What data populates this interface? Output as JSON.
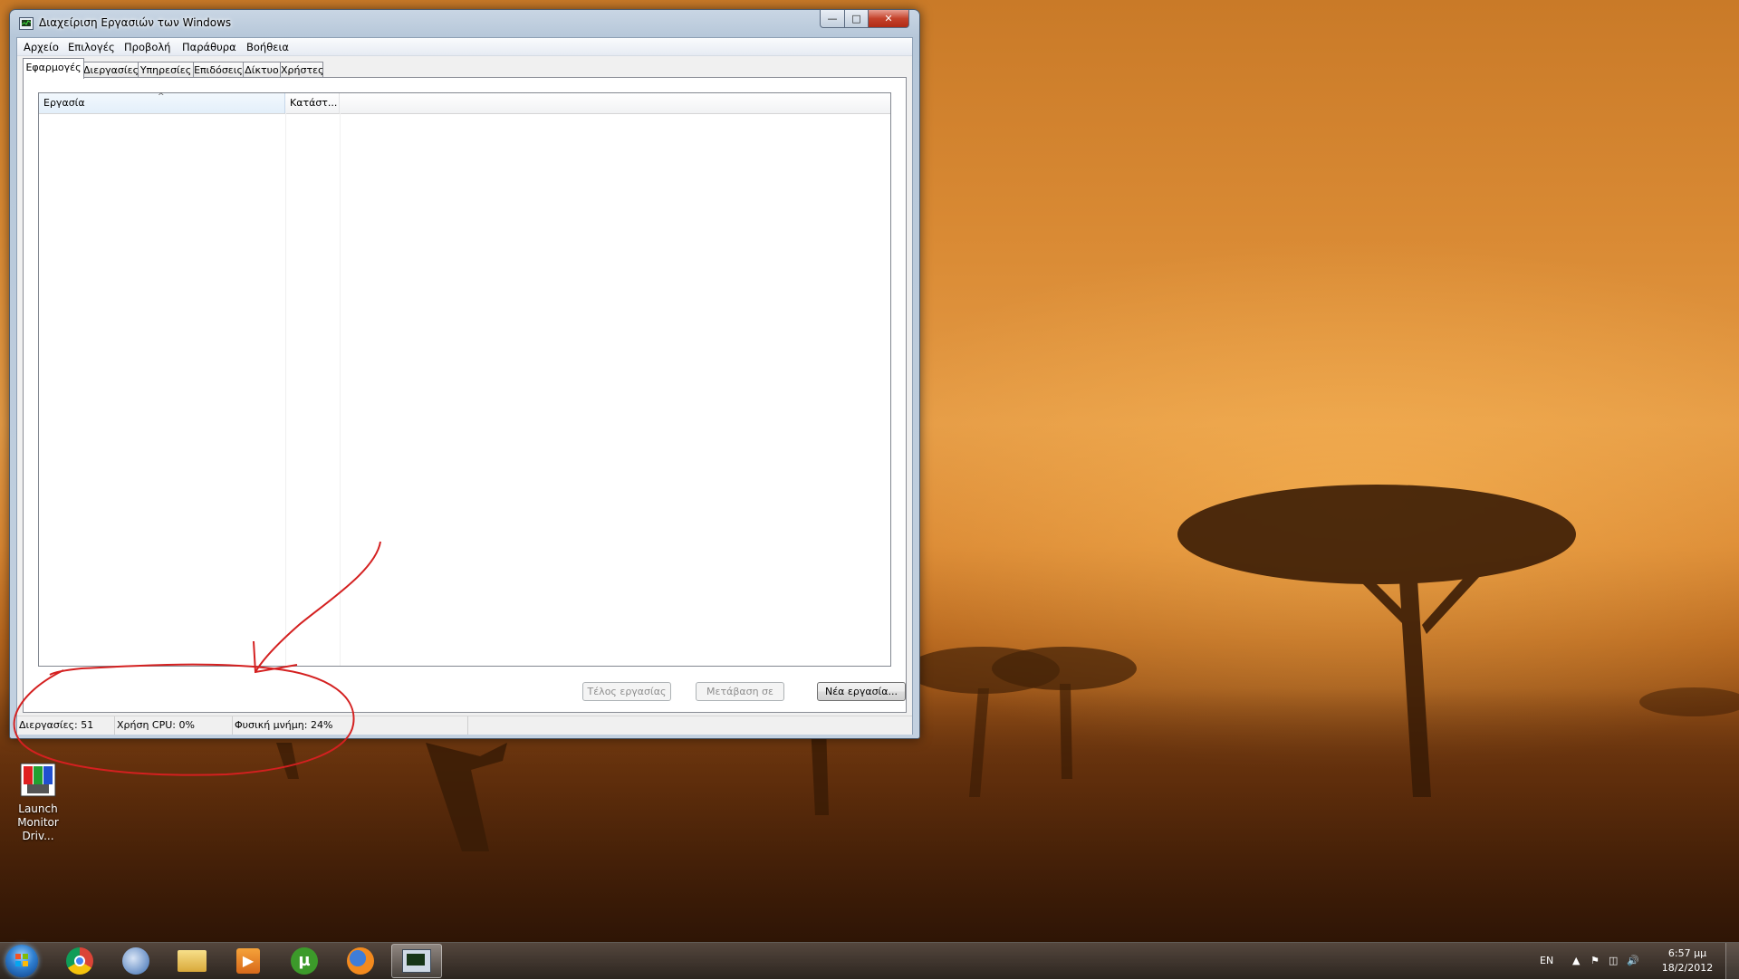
{
  "window": {
    "title": "Διαχείριση Εργασιών των Windows",
    "menu": [
      "Αρχείο",
      "Επιλογές",
      "Προβολή",
      "Παράθυρα",
      "Βοήθεια"
    ],
    "tabs": [
      "Εφαρμογές",
      "Διεργασίες",
      "Υπηρεσίες",
      "Επιδόσεις",
      "Δίκτυο",
      "Χρήστες"
    ],
    "active_tab": "Εφαρμογές",
    "list_columns": [
      "Εργασία",
      "Κατάστ..."
    ],
    "buttons": {
      "end_task": "Τέλος εργασίας",
      "switch_to": "Μετάβαση σε",
      "new_task": "Νέα εργασία..."
    },
    "status": {
      "processes": "Διεργασίες: 51",
      "cpu": "Χρήση CPU: 0%",
      "memory": "Φυσική μνήμη: 24%"
    }
  },
  "desktop_icon": {
    "label_line1": "Launch",
    "label_line2": "Monitor Driv..."
  },
  "taskbar": {
    "apps": [
      "chrome-icon",
      "thunderbird-icon",
      "explorer-icon",
      "media-player-icon",
      "utorrent-icon",
      "firefox-icon",
      "task-manager-icon"
    ],
    "language": "EN",
    "time": "6:57 μμ",
    "date": "18/2/2012"
  },
  "colors": {
    "annotation": "#d42020",
    "wallpaper_top": "#c97a28",
    "wallpaper_bottom": "#4a2408"
  }
}
